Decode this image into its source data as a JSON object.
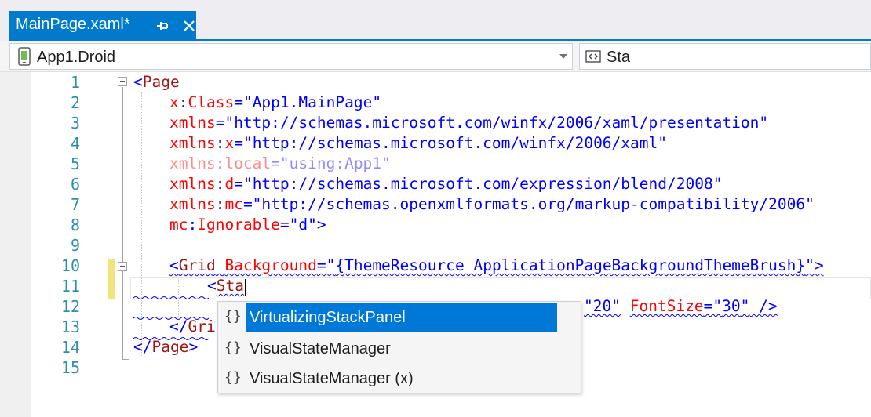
{
  "tab": {
    "title": "MainPage.xaml*",
    "pin_icon": "pin-icon",
    "close_icon": "close-icon"
  },
  "navbar": {
    "project": "App1.Droid",
    "project_icon": "android-project-icon",
    "element": "Sta",
    "element_icon": "xaml-element-icon"
  },
  "editor": {
    "line_numbers": [
      "1",
      "2",
      "3",
      "4",
      "5",
      "6",
      "7",
      "8",
      "9",
      "10",
      "11",
      "12",
      "13",
      "14",
      "15"
    ],
    "lines": {
      "l1": {
        "open": "<",
        "tag": "Page"
      },
      "l2": {
        "ns": "x",
        "colon": ":",
        "attr": "Class",
        "eq": "=\"",
        "val": "App1.MainPage",
        "q": "\""
      },
      "l3": {
        "attr": "xmlns",
        "eq": "=\"",
        "val": "http://schemas.microsoft.com/winfx/2006/xaml/presentation",
        "q": "\""
      },
      "l4": {
        "ns": "xmlns",
        "colon": ":",
        "attr": "x",
        "eq": "=\"",
        "val": "http://schemas.microsoft.com/winfx/2006/xaml",
        "q": "\""
      },
      "l5": {
        "ns": "xmlns",
        "colon": ":",
        "attr": "local",
        "eq": "=\"",
        "val": "using:App1",
        "q": "\""
      },
      "l6": {
        "ns": "xmlns",
        "colon": ":",
        "attr": "d",
        "eq": "=\"",
        "val": "http://schemas.microsoft.com/expression/blend/2008",
        "q": "\""
      },
      "l7": {
        "ns": "xmlns",
        "colon": ":",
        "attr": "mc",
        "eq": "=\"",
        "val": "http://schemas.openxmlformats.org/markup-compatibility/2006",
        "q": "\""
      },
      "l8": {
        "ns": "mc",
        "colon": ":",
        "attr": "Ignorable",
        "eq": "=\"",
        "val": "d",
        "q": "\">"
      },
      "l10": {
        "open": "<",
        "tag": "Grid",
        "sp": " ",
        "attr": "Background",
        "eq": "=\"",
        "val": "{ThemeResource ApplicationPageBackgroundThemeBrush}",
        "q": "\">"
      },
      "l11": {
        "open": "<",
        "tag": "Sta"
      },
      "l12": {
        "t1": "\"20\"",
        "sp": " ",
        "attr": "FontSize",
        "eq": "=\"",
        "val": "30",
        "q": "\"",
        "close": " />"
      },
      "l13": {
        "open": "</",
        "tag": "Gri"
      },
      "l14": {
        "open": "</",
        "tag": "Page",
        "close": ">"
      }
    }
  },
  "completion": {
    "item_icon": "xaml-element-braces-icon",
    "glyph": "{}",
    "items": [
      {
        "label": "VirtualizingStackPanel",
        "selected": true
      },
      {
        "label": "VisualStateManager",
        "selected": false
      },
      {
        "label": "VisualStateManager (x)",
        "selected": false
      }
    ]
  },
  "colors": {
    "tab_accent": "#007acc",
    "selection": "#0078d7",
    "line_number": "#2b91af",
    "markup": "#0000ff",
    "element": "#a31515",
    "attribute": "#ff0000",
    "change_bar": "#efe57a"
  }
}
